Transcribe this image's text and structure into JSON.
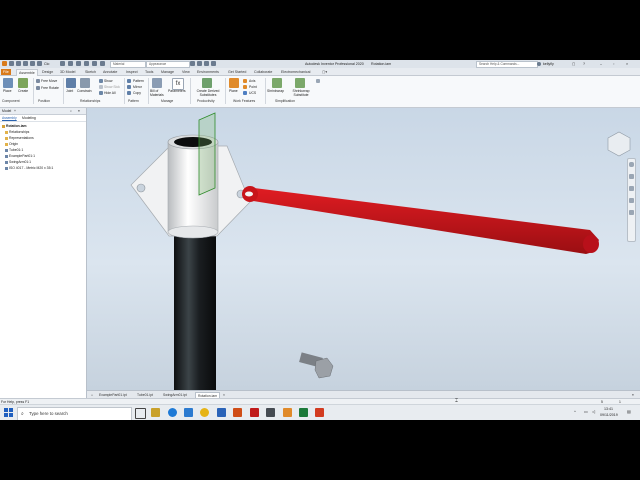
{
  "titlebar": {
    "app_title": "Autodesk Inventor Professional 2020",
    "doc_name": "Rotation.iam",
    "material": "Material",
    "appearance": "Appearance",
    "search_placeholder": "Search Help & Commands...",
    "user": "kellyfly",
    "undo_label": "Clo"
  },
  "tabs": [
    {
      "label": "File"
    },
    {
      "label": "Assemble"
    },
    {
      "label": "Design"
    },
    {
      "label": "3D Model"
    },
    {
      "label": "Sketch"
    },
    {
      "label": "Annotate"
    },
    {
      "label": "Inspect"
    },
    {
      "label": "Tools"
    },
    {
      "label": "Manage"
    },
    {
      "label": "View"
    },
    {
      "label": "Environments"
    },
    {
      "label": "Get Started"
    },
    {
      "label": "Collaborate"
    },
    {
      "label": "Electromechanical"
    }
  ],
  "ribbon": {
    "place": "Place",
    "create": "Create",
    "free_move": "Free Move",
    "free_rotate": "Free Rotate",
    "joint": "Joint",
    "constrain": "Constrain",
    "show": "Show",
    "show_sick": "Show Sick",
    "hide_all": "Hide All",
    "pattern": "Pattern",
    "mirror": "Mirror",
    "copy": "Copy",
    "bill_of_materials": "Bill of Materials",
    "parameters": "Parameters",
    "create_derived": "Create Derived Substitutes",
    "plane": "Plane",
    "axis": "Axis",
    "point": "Point",
    "ucs": "UCS",
    "shrinkwrap": "Shrinkwrap",
    "shrinkwrap_substitute": "Shrinkwrap Substitute"
  },
  "groups": {
    "component": "Component",
    "position": "Position",
    "relationships": "Relationships",
    "pattern": "Pattern",
    "manage": "Manage",
    "productivity": "Productivity",
    "work_features": "Work Features",
    "simplification": "Simplification"
  },
  "browser": {
    "tab_model": "Model",
    "tab_add": "+",
    "sub_assembly": "Assembly",
    "sub_modeling": "Modeling",
    "items": [
      {
        "label": "Rotation.iam"
      },
      {
        "label": "Relationships"
      },
      {
        "label": "Representations"
      },
      {
        "label": "Origin"
      },
      {
        "label": "Tube01:1"
      },
      {
        "label": "ExamplePart01:1"
      },
      {
        "label": "SwingArm01:1"
      },
      {
        "label": "ISO 4017 - Metric M20 x 35:1"
      }
    ]
  },
  "doc_tabs": [
    {
      "label": "ExamplePart01.ipt"
    },
    {
      "label": "Tube01.ipt"
    },
    {
      "label": "SwingArm01.ipt"
    },
    {
      "label": "Rotation.iam"
    }
  ],
  "status": {
    "help": "For Help, press F1",
    "count_a": "5",
    "count_b": "1"
  },
  "taskbar": {
    "search_placeholder": "Type here to search",
    "time": "13:41",
    "date": "09/11/2019"
  },
  "colors": {
    "swing_arm": "#c8141a",
    "tube": "#1b1f22",
    "ribbon_accent": "#d97a1a"
  }
}
